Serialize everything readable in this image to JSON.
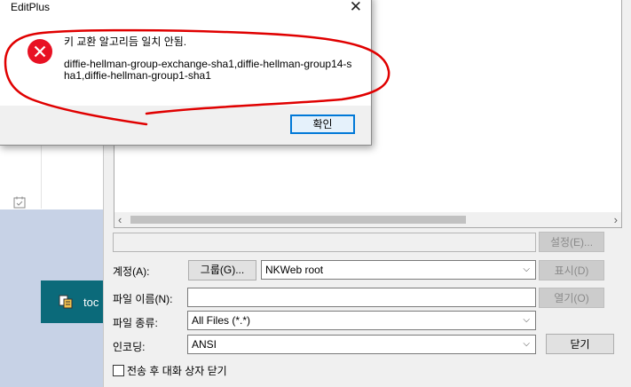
{
  "message_box": {
    "title": "EditPlus",
    "close_glyph": "✕",
    "line1": "키 교환 알고리듬 일치 안됨.",
    "line2": "diffie-hellman-group-exchange-sha1,diffie-hellman-group14-sha1,diffie-hellman-group1-sha1",
    "ok_label": "확인",
    "icon": "error-icon",
    "icon_color": "#e81123"
  },
  "background_app": {
    "taskbar_label": "toc",
    "taskbar_color": "#0b6a7a"
  },
  "file_dialog": {
    "settings_btn": "설정(E)...",
    "account_label": "계정(A):",
    "group_btn": "그룹(G)...",
    "account_value": "NKWeb root",
    "show_btn": "표시(D)",
    "filename_label": "파일 이름(N):",
    "filename_value": "",
    "open_btn": "열기(O)",
    "filetype_label": "파일 종류:",
    "filetype_value": "All Files (*.*)",
    "encoding_label": "인코딩:",
    "encoding_value": "ANSI",
    "close_btn": "닫기",
    "close_after_label": "전송 후 대화 상자 닫기"
  },
  "annotation": {
    "color": "#e00000"
  }
}
